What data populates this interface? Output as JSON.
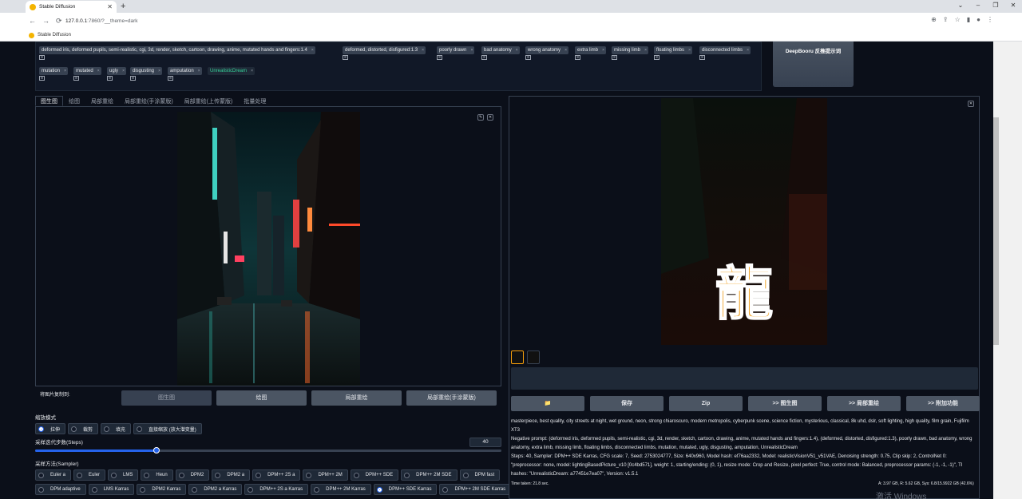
{
  "browser": {
    "tab_title": "Stable Diffusion",
    "url_host": "127.0.0.1",
    "url_rest": ":7860/?__theme=dark",
    "bookmark": "Stable Diffusion"
  },
  "tags_row1": [
    "deformed iris, deformed pupils, semi-realistic, cgi, 3d, render, sketch, cartoon, drawing, anime, mutated hands and fingers:1.4",
    "deformed, distorted, disfigured:1.3",
    "poorly drawn",
    "bad anatomy",
    "wrong anatomy",
    "extra limb",
    "missing limb",
    "floating limbs",
    "disconnected limbs"
  ],
  "tags_row2": [
    "mutation",
    "mutated",
    "ugly",
    "disgusting",
    "amputation",
    "UnrealisticDream"
  ],
  "tag_sub": "⊞",
  "deepbooru_label": "DeepBooru 反推提示词",
  "tabs": [
    "图生图",
    "绘图",
    "局部重绘",
    "局部重绘(手涂蒙版)",
    "局部重绘(上传蒙版)",
    "批量处理"
  ],
  "copy_label": "将图片复制到:",
  "copy_buttons": [
    "图生图",
    "绘图",
    "局部重绘",
    "局部重绘(手涂蒙版)"
  ],
  "resize_label": "缩放模式",
  "resize_options": [
    "拉伸",
    "裁剪",
    "填充",
    "直接缩放 (放大潜变量)"
  ],
  "steps_label": "采样迭代步数(Steps)",
  "steps_value": "40",
  "steps_fraction": 0.26,
  "sampler_label": "采样方法(Sampler)",
  "samplers_row1": [
    "Euler a",
    "Euler",
    "LMS",
    "Heun",
    "DPM2",
    "DPM2 a",
    "DPM++ 2S a",
    "DPM++ 2M",
    "DPM++ SDE",
    "DPM++ 2M SDE",
    "DPM fast"
  ],
  "samplers_row2": [
    "DPM adaptive",
    "LMS Karras",
    "DPM2 Karras",
    "DPM2 a Karras",
    "DPM++ 2S a Karras",
    "DPM++ 2M Karras",
    "DPM++ SDE Karras",
    "DPM++ 2M SDE Karras"
  ],
  "selected_sampler": "DPM++ SDE Karras",
  "action_buttons": [
    "📁",
    "保存",
    "Zip",
    ">> 图生图",
    ">> 局部重绘",
    ">> 附加功能"
  ],
  "info": {
    "prompt": "masterpiece, best quality, city streets at night, wet ground, neon, strong chiaroscuro, modern metropolis, cyberpunk scene, science fiction, mysterious, classical, 8k uhd, dslr, soft lighting, high quality, film grain, Fujifilm XT3",
    "negative": "Negative prompt: (deformed iris, deformed pupils, semi-realistic, cgi, 3d, render, sketch, cartoon, drawing, anime, mutated hands and fingers:1.4), (deformed, distorted, disfigured:1.3), poorly drawn, bad anatomy, wrong anatomy, extra limb, missing limb, floating limbs, disconnected limbs, mutation, mutated, ugly, disgusting, amputation, UnrealisticDream",
    "params": "Steps: 40, Sampler: DPM++ SDE Karras, CFG scale: 7, Seed: 2753024777, Size: 640x960, Model hash: ef76aa2332, Model: realisticVisionV51_v51VAE, Denoising strength: 0.75, Clip skip: 2, ControlNet 0: \"preprocessor: none, model: lightingBasedPicture_v10 [0c4bd571], weight: 1, starting/ending: (0, 1), resize mode: Crop and Resize, pixel perfect: True, control mode: Balanced, preprocessor params: (-1, -1, -1)\", TI hashes: \"UnrealisticDream: a77451e7ea07\", Version: v1.5.1"
  },
  "time_taken": "Time taken: 21.8 sec.",
  "vram": "A: 3.97 GB, R: 5.62 GB, Sys: 6.8/15.9922 GB (42.6%)",
  "watermark": "激活 Windows",
  "output_glyph": "龍"
}
